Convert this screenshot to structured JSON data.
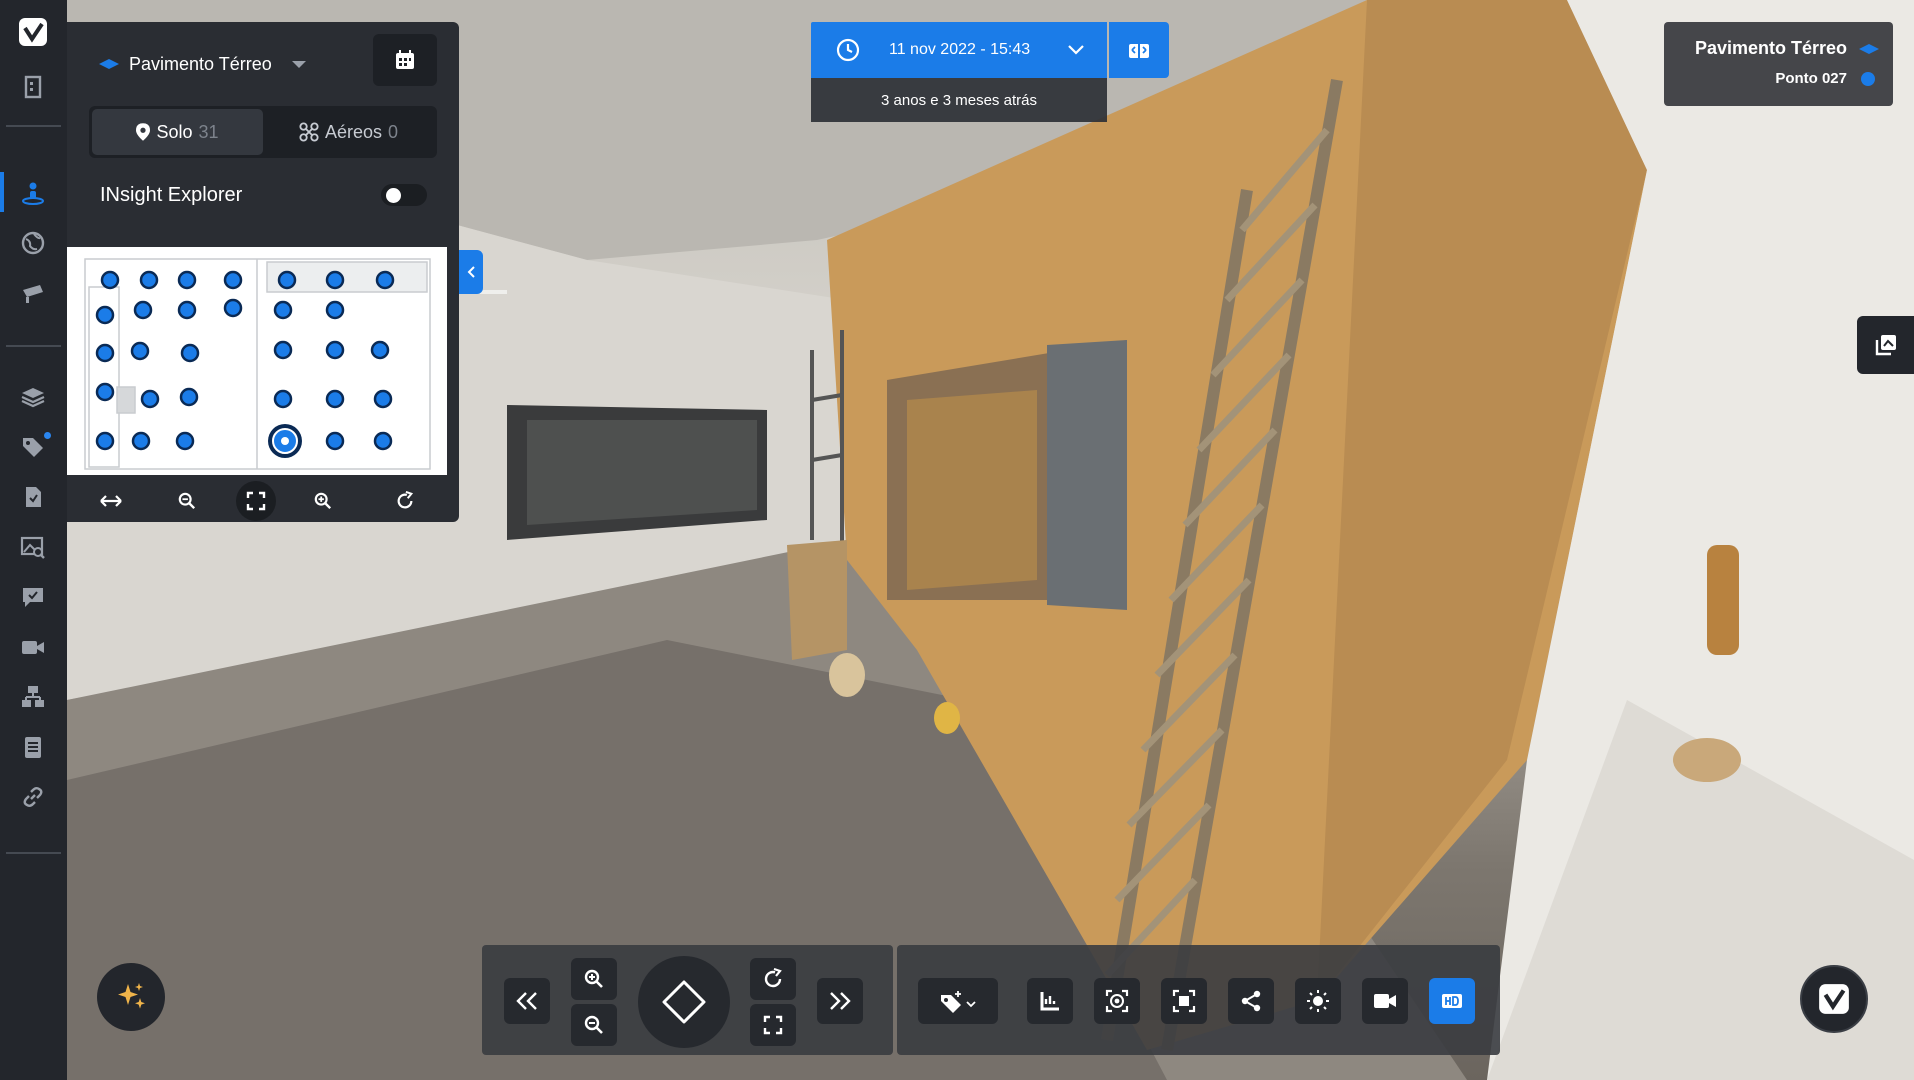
{
  "floor_panel": {
    "floor_name": "Pavimento Térreo",
    "tabs": [
      {
        "label": "Solo",
        "count": "31",
        "selected": true,
        "icon": "map-pin-icon"
      },
      {
        "label": "Aéreos",
        "count": "0",
        "selected": false,
        "icon": "drone-icon"
      }
    ],
    "insight_label": "INsight Explorer",
    "insight_enabled": false,
    "map_tools": [
      "fit-width-icon",
      "zoom-out-icon",
      "fullscreen-icon",
      "zoom-in-icon",
      "rotate-icon"
    ]
  },
  "capture": {
    "date_label": "11 nov 2022 - 15:43",
    "relative_label": "3 anos e 3 meses atrás"
  },
  "location": {
    "floor": "Pavimento Térreo",
    "point": "Ponto 027"
  },
  "sidebar_icons": [
    "building-icon",
    "person-360-icon",
    "globe-icon",
    "drone-camera-icon",
    "layers-icon",
    "tag-icon",
    "document-icon",
    "image-search-icon",
    "comment-icon",
    "video-icon",
    "network-icon",
    "checklist-icon",
    "link-icon"
  ],
  "toolbar_icons": [
    "add-tag-icon",
    "measure-icon",
    "target-icon",
    "screenshot-icon",
    "share-icon",
    "brightness-icon",
    "video-record-icon",
    "hd-icon"
  ],
  "colors": {
    "accent": "#1b7ce8",
    "panel": "#2a2d33",
    "rail": "#23262c"
  }
}
